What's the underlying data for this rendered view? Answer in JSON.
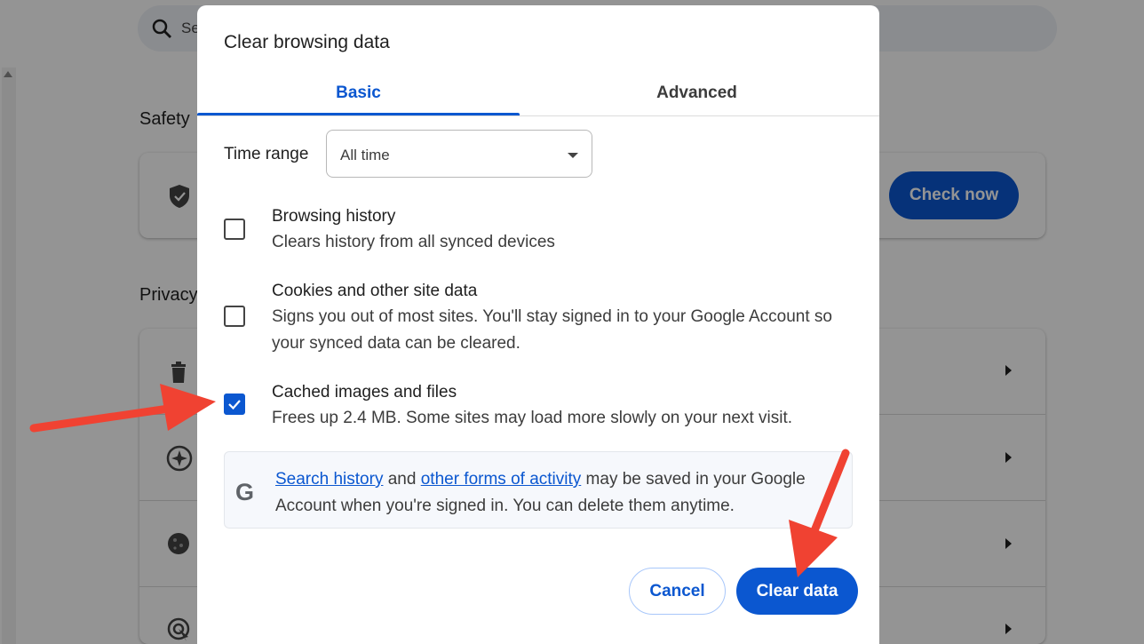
{
  "background": {
    "search_partial": "Se",
    "safety_heading": "Safety",
    "check_now_label": "Check now",
    "privacy_heading": "Privacy"
  },
  "dialog": {
    "title": "Clear browsing data",
    "tabs": [
      {
        "label": "Basic",
        "selected": true
      },
      {
        "label": "Advanced",
        "selected": false
      }
    ],
    "time_range": {
      "label": "Time range",
      "value": "All time"
    },
    "options": [
      {
        "title": "Browsing history",
        "description": "Clears history from all synced devices",
        "checked": false
      },
      {
        "title": "Cookies and other site data",
        "description": "Signs you out of most sites. You'll stay signed in to your Google Account so your synced data can be cleared.",
        "checked": false
      },
      {
        "title": "Cached images and files",
        "description": "Frees up 2.4 MB. Some sites may load more slowly on your next visit.",
        "checked": true
      }
    ],
    "info": {
      "link1": "Search history",
      "text1": " and ",
      "link2": "other forms of activity",
      "text2": " may be saved in your Google Account when you're signed in. You can delete them anytime."
    },
    "buttons": {
      "cancel": "Cancel",
      "clear": "Clear data"
    }
  },
  "colors": {
    "accent": "#0b57d0",
    "annotation_arrow": "#f04232"
  }
}
